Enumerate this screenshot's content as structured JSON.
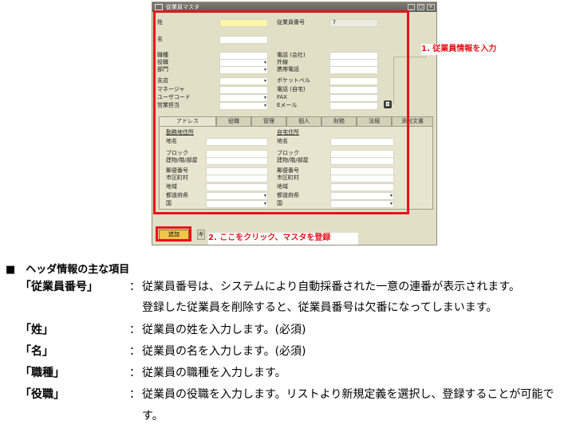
{
  "window": {
    "title": "従業員マスタ",
    "labels": {
      "last_name": "姓",
      "first_name": "名",
      "employee_no": "従業員番号",
      "job_title": "職種",
      "position": "役職",
      "department": "部門",
      "branch": "支店",
      "manager": "マネージャ",
      "user_code": "ユーザコード",
      "sales_person": "営業担当",
      "office_phone": "電話 (会社)",
      "extension": "外線",
      "mobile_phone": "携帯電話",
      "pager": "ポケットベル",
      "home_phone": "電話 (自宅)",
      "fax": "FAX",
      "email": "Eメール"
    },
    "values": {
      "employee_no": "7"
    },
    "tabs": [
      "アドレス",
      "役職",
      "管理",
      "個人",
      "財務",
      "法規",
      "添付文書"
    ],
    "address": {
      "work_heading": "勤務地住所",
      "home_heading": "自宅住所",
      "work_rows": [
        "地名",
        "ブロック",
        "建物/階/部屋",
        "郵便番号",
        "市区町村",
        "地域",
        "都道府県",
        "国"
      ],
      "home_rows": [
        "地名",
        "ブロック",
        "建物/階/部屋",
        "郵便番号",
        "市区町村",
        "地域",
        "都道府県",
        "国"
      ]
    },
    "buttons": {
      "add": "追加",
      "next": "キ"
    }
  },
  "annotations": {
    "step1": "1. 従業員情報を入力",
    "step2": "2. ここをクリック、マスタを登録"
  },
  "doc": {
    "heading": "■　ヘッダ情報の主な項目",
    "items": [
      {
        "term": "「従業員番号」",
        "colon": "：",
        "lines": [
          "従業員番号は、システムにより自動採番された一意の連番が表示されます。",
          "登録した従業員を削除すると、従業員番号は欠番になってしまいます。"
        ]
      },
      {
        "term": "「姓」",
        "colon": "：",
        "lines": [
          "従業員の姓を入力します。(必須)"
        ]
      },
      {
        "term": "「名」",
        "colon": "：",
        "lines": [
          "従業員の名を入力します。(必須)"
        ]
      },
      {
        "term": "「職種」",
        "colon": "：",
        "lines": [
          "従業員の職種を入力します。"
        ]
      },
      {
        "term": "「役職」",
        "colon": "：",
        "lines": [
          "従業員の役職を入力します。リストより新規定義を選択し、登録することが可能で",
          "す。"
        ]
      }
    ]
  }
}
